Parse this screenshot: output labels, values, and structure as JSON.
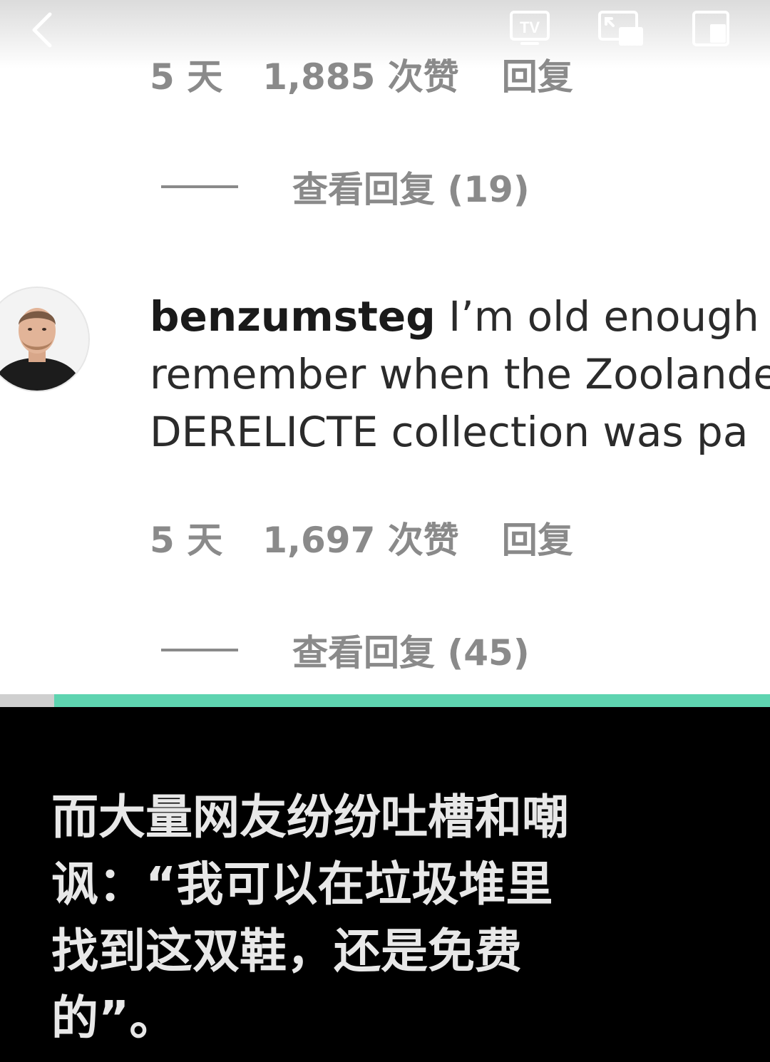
{
  "top_bar": {
    "icons": [
      "back-icon",
      "tv-icon",
      "cast-icon",
      "picture-in-picture-icon"
    ],
    "tv_label": "TV"
  },
  "comment_prev": {
    "days": "5 天",
    "likes": "1,885 次赞",
    "reply": "回复",
    "view_replies": "查看回复 (19)"
  },
  "comment": {
    "username": "benzumsteg",
    "text_lines": [
      "I’m old enough to",
      "remember when the Zoolander",
      "DERELICTE collection was pa"
    ],
    "days": "5 天",
    "likes": "1,697 次赞",
    "reply": "回复",
    "view_replies": "查看回复 (45)"
  },
  "playback": {
    "progress": 0.07,
    "accent_color": "#5ed4b0"
  },
  "caption": {
    "lines": [
      "而大量网友纷纷吐槽和嘲",
      "讽：“我可以在垃圾堆里",
      "找到这双鞋，还是免费",
      "的”。"
    ]
  }
}
